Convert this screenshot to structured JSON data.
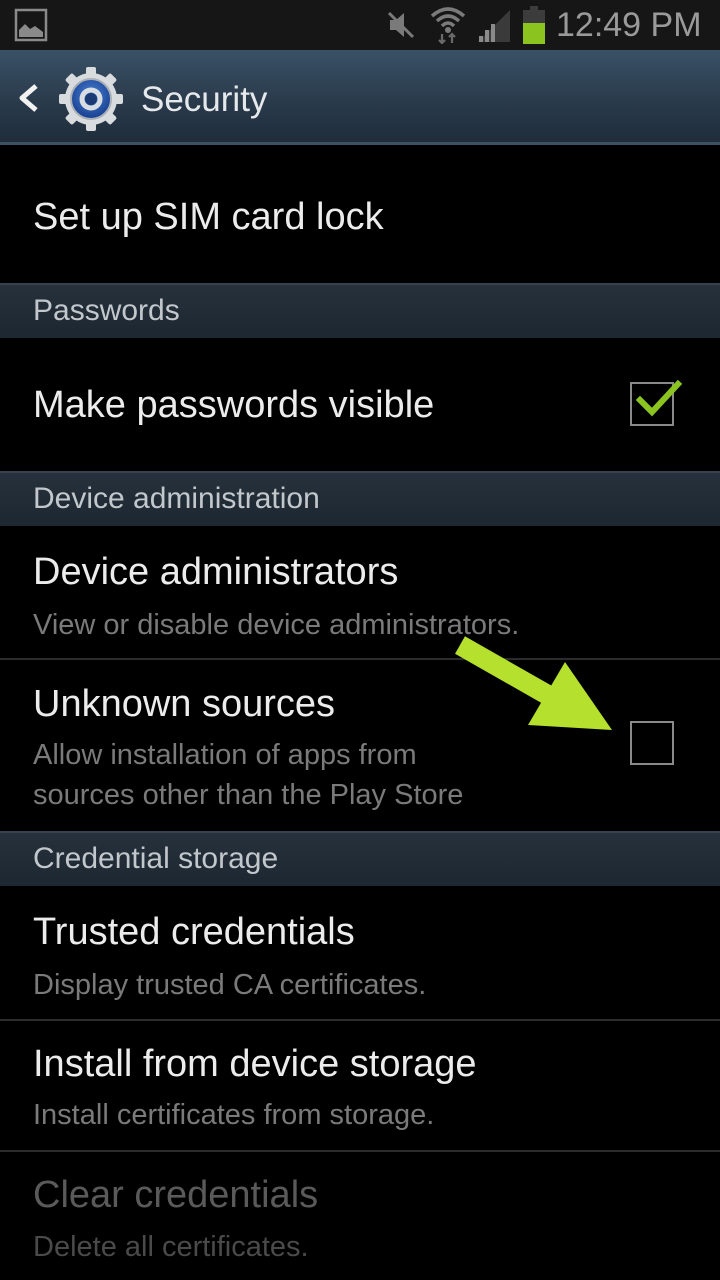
{
  "status_bar": {
    "time": "12:49 PM",
    "icons": [
      "gallery-notification-icon",
      "mute-icon",
      "wifi-icon",
      "signal-icon",
      "battery-icon"
    ],
    "battery_color": "#8cc41f"
  },
  "action_bar": {
    "back_icon": "chevron-left-icon",
    "app_icon": "settings-gear-icon",
    "title": "Security"
  },
  "list": {
    "sim_lock": {
      "title": "Set up SIM card lock"
    },
    "sections": {
      "passwords": "Passwords",
      "device_admin": "Device administration",
      "credential_storage": "Credential storage"
    },
    "make_passwords_visible": {
      "title": "Make passwords visible",
      "checked": true
    },
    "device_administrators": {
      "title": "Device administrators",
      "subtitle": "View or disable device administrators."
    },
    "unknown_sources": {
      "title": "Unknown sources",
      "subtitle_line1": "Allow installation of apps from",
      "subtitle_line2": "sources other than the Play Store",
      "checked": false
    },
    "trusted_credentials": {
      "title": "Trusted credentials",
      "subtitle": "Display trusted CA certificates."
    },
    "install_from_storage": {
      "title": "Install from device storage",
      "subtitle": "Install certificates from storage."
    },
    "clear_credentials": {
      "title": "Clear credentials",
      "subtitle": "Delete all certificates.",
      "enabled": false
    }
  },
  "annotation": {
    "type": "arrow",
    "target": "unknown-sources-checkbox",
    "color": "#b5e02e"
  },
  "colors": {
    "check": "#8cc41f",
    "accent_header": "#2a3b4c"
  }
}
